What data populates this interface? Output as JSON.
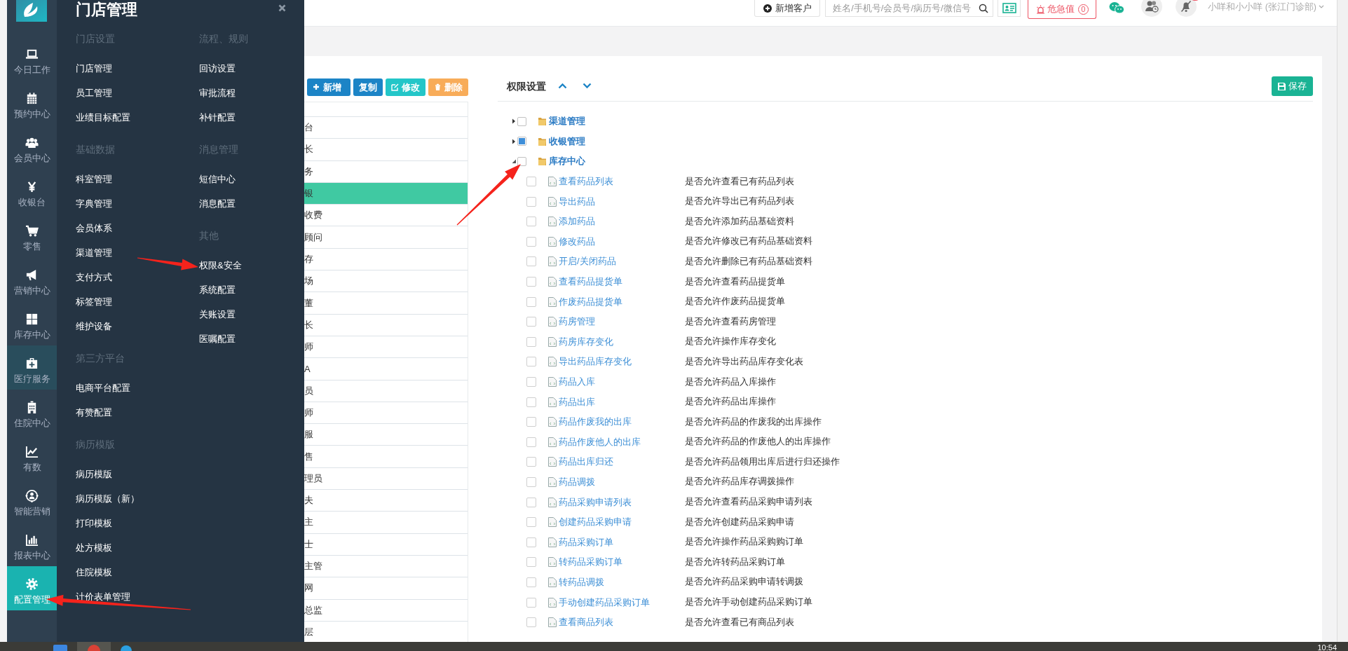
{
  "sidebar": {
    "items": [
      {
        "label": "今日工作",
        "selected": false,
        "hovered": false
      },
      {
        "label": "预约中心",
        "selected": false,
        "hovered": false
      },
      {
        "label": "会员中心",
        "selected": false,
        "hovered": false
      },
      {
        "label": "收银台",
        "selected": false,
        "hovered": false
      },
      {
        "label": "零售",
        "selected": false,
        "hovered": false
      },
      {
        "label": "营销中心",
        "selected": false,
        "hovered": false
      },
      {
        "label": "库存中心",
        "selected": false,
        "hovered": false
      },
      {
        "label": "医疗服务",
        "selected": false,
        "hovered": true
      },
      {
        "label": "住院中心",
        "selected": false,
        "hovered": false
      },
      {
        "label": "有数",
        "selected": false,
        "hovered": false
      },
      {
        "label": "智能营销",
        "selected": false,
        "hovered": false
      },
      {
        "label": "报表中心",
        "selected": false,
        "hovered": false
      },
      {
        "label": "配置管理",
        "selected": true,
        "hovered": false
      }
    ]
  },
  "menu": {
    "title": "门店管理",
    "columns": [
      [
        {
          "heading": "门店设置",
          "items": [
            "门店管理",
            "员工管理",
            "业绩目标配置"
          ]
        },
        {
          "heading": "基础数据",
          "items": [
            "科室管理",
            "字典管理",
            "会员体系",
            "渠道管理",
            "支付方式",
            "标签管理",
            "维护设备"
          ]
        },
        {
          "heading": "第三方平台",
          "items": [
            "电商平台配置",
            "有赞配置"
          ]
        },
        {
          "heading": "病历模版",
          "items": [
            "病历模版",
            "病历模版（新）",
            "打印模板",
            "处方模板",
            "住院模板",
            "计价表单管理"
          ]
        }
      ],
      [
        {
          "heading": "流程、规则",
          "items": [
            "回访设置",
            "审批流程",
            "补针配置"
          ]
        },
        {
          "heading": "消息管理",
          "items": [
            "短信中心",
            "消息配置"
          ]
        },
        {
          "heading": "其他",
          "items": [
            "权限&安全",
            "系统配置",
            "关账设置",
            "医嘱配置"
          ]
        }
      ]
    ]
  },
  "top_bar": {
    "new_customer": "新增客户",
    "search": {
      "placeholder": "姓名/手机号/会员号/病历号/微信号"
    },
    "alert": {
      "label": "危急值",
      "count": "0"
    },
    "user": "小咩和小小咩 (张江门诊部)"
  },
  "role_panel": {
    "buttons": [
      {
        "label": "新增",
        "kind": "primary"
      },
      {
        "label": "复制",
        "kind": "primary"
      },
      {
        "label": "修改",
        "kind": "info"
      },
      {
        "label": "删除",
        "kind": "warning"
      }
    ],
    "rows": [
      {
        "text": "台",
        "selected": false
      },
      {
        "text": "长",
        "selected": false
      },
      {
        "text": "务",
        "selected": false
      },
      {
        "text": "银",
        "selected": true
      },
      {
        "text": "收费",
        "selected": false
      },
      {
        "text": "顾问",
        "selected": false
      },
      {
        "text": "存",
        "selected": false
      },
      {
        "text": "场",
        "selected": false
      },
      {
        "text": "董",
        "selected": false
      },
      {
        "text": "长",
        "selected": false
      },
      {
        "text": "师",
        "selected": false
      },
      {
        "text": "A",
        "selected": false
      },
      {
        "text": "员",
        "selected": false
      },
      {
        "text": "师",
        "selected": false
      },
      {
        "text": "服",
        "selected": false
      },
      {
        "text": "售",
        "selected": false
      },
      {
        "text": "理员",
        "selected": false
      },
      {
        "text": "夫",
        "selected": false
      },
      {
        "text": "主",
        "selected": false
      },
      {
        "text": "士",
        "selected": false
      },
      {
        "text": "主管",
        "selected": false
      },
      {
        "text": "网",
        "selected": false
      },
      {
        "text": "总监",
        "selected": false
      },
      {
        "text": "层",
        "selected": false
      }
    ]
  },
  "permissions": {
    "title": "权限设置",
    "save": "保存",
    "tree": [
      {
        "label": "渠道管理",
        "expanded": false,
        "checked": false,
        "partial": false
      },
      {
        "label": "收银管理",
        "expanded": false,
        "checked": false,
        "partial": true
      },
      {
        "label": "库存中心",
        "expanded": true,
        "checked": false,
        "partial": false,
        "children": [
          {
            "label": "查看药品列表",
            "description": "是否允许查看已有药品列表",
            "checked": false
          },
          {
            "label": "导出药品",
            "description": "是否允许导出已有药品列表",
            "checked": false
          },
          {
            "label": "添加药品",
            "description": "是否允许添加药品基础资料",
            "checked": false
          },
          {
            "label": "修改药品",
            "description": "是否允许修改已有药品基础资料",
            "checked": false
          },
          {
            "label": "开启/关闭药品",
            "description": "是否允许删除已有药品基础资料",
            "checked": false
          },
          {
            "label": "查看药品提货单",
            "description": "是否允许查看药品提货单",
            "checked": false
          },
          {
            "label": "作废药品提货单",
            "description": "是否允许作废药品提货单",
            "checked": false
          },
          {
            "label": "药房管理",
            "description": "是否允许查看药房管理",
            "checked": false
          },
          {
            "label": "药房库存变化",
            "description": "是否允许操作库存变化",
            "checked": false
          },
          {
            "label": "导出药品库存变化",
            "description": "是否允许导出药品库存变化表",
            "checked": false
          },
          {
            "label": "药品入库",
            "description": "是否允许药品入库操作",
            "checked": false
          },
          {
            "label": "药品出库",
            "description": "是否允许药品出库操作",
            "checked": false
          },
          {
            "label": "药品作废我的出库",
            "description": "是否允许药品的作废我的出库操作",
            "checked": false
          },
          {
            "label": "药品作废他人的出库",
            "description": "是否允许药品的作废他人的出库操作",
            "checked": false
          },
          {
            "label": "药品出库归还",
            "description": "是否允许药品领用出库后进行归还操作",
            "checked": false
          },
          {
            "label": "药品调拨",
            "description": "是否允许药品库存调拨操作",
            "checked": false
          },
          {
            "label": "药品采购申请列表",
            "description": "是否允许查看药品采购申请列表",
            "checked": false
          },
          {
            "label": "创建药品采购申请",
            "description": "是否允许创建药品采购申请",
            "checked": false
          },
          {
            "label": "药品采购订单",
            "description": "是否允许操作药品采购购订单",
            "checked": false
          },
          {
            "label": "转药品采购订单",
            "description": "是否允许转药品采购订单",
            "checked": false
          },
          {
            "label": "转药品调拨",
            "description": "是否允许药品采购申请转调拨",
            "checked": false
          },
          {
            "label": "手动创建药品采购订单",
            "description": "是否允许手动创建药品采购订单",
            "checked": false
          },
          {
            "label": "查看商品列表",
            "description": "是否允许查看已有商品列表",
            "checked": false
          }
        ]
      }
    ]
  },
  "taskbar": {
    "time": "10:54"
  }
}
